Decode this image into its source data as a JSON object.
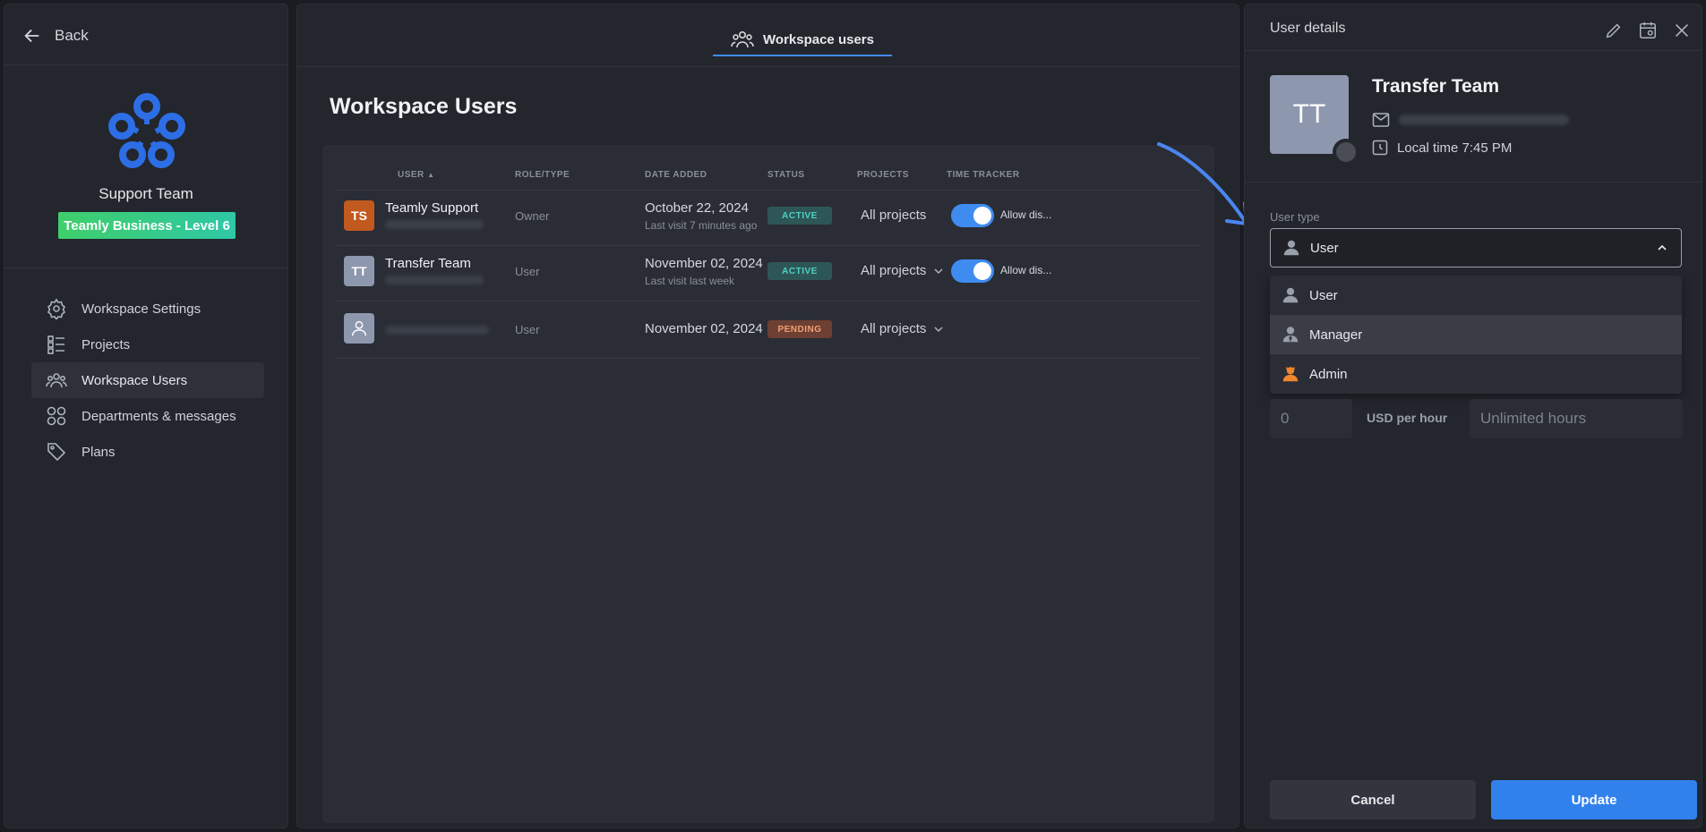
{
  "sidebar": {
    "back_label": "Back",
    "team_name": "Support Team",
    "plan_badge": "Teamly Business - Level 6",
    "nav": [
      {
        "label": "Workspace Settings",
        "icon": "gear-icon"
      },
      {
        "label": "Projects",
        "icon": "list-icon"
      },
      {
        "label": "Workspace Users",
        "icon": "users-icon"
      },
      {
        "label": "Departments & messages",
        "icon": "grid-icon"
      },
      {
        "label": "Plans",
        "icon": "tag-icon"
      }
    ]
  },
  "main": {
    "tab_label": "Workspace users",
    "title": "Workspace Users",
    "columns": {
      "user": "USER",
      "role": "ROLE/TYPE",
      "date": "DATE ADDED",
      "status": "STATUS",
      "projects": "PROJECTS",
      "time_tracker": "TIME TRACKER"
    },
    "rows": [
      {
        "initials": "TS",
        "name": "Teamly Support",
        "role": "Owner",
        "date": "October 22, 2024",
        "last_visit": "Last visit 7 minutes ago",
        "status": "ACTIVE",
        "projects": "All projects",
        "tracker_label": "Allow dis..."
      },
      {
        "initials": "TT",
        "name": "Transfer Team",
        "role": "User",
        "date": "November 02, 2024",
        "last_visit": "Last visit last week",
        "status": "ACTIVE",
        "projects": "All projects",
        "tracker_label": "Allow dis..."
      },
      {
        "initials": "",
        "name": "",
        "role": "User",
        "date": "November 02, 2024",
        "last_visit": "",
        "status": "PENDING",
        "projects": "All projects",
        "tracker_label": ""
      }
    ]
  },
  "details": {
    "title": "User details",
    "avatar_initials": "TT",
    "name": "Transfer Team",
    "local_time": "Local time 7:45 PM",
    "user_type_label": "User type",
    "selected_type": "User",
    "options": [
      "User",
      "Manager",
      "Admin"
    ],
    "rate_value": "0",
    "rate_unit": "USD per hour",
    "hours_placeholder": "Unlimited hours",
    "cancel_label": "Cancel",
    "update_label": "Update"
  },
  "colors": {
    "accent": "#3f8cf0",
    "active_badge": "#4fd1c1",
    "pending_badge": "#f0a074",
    "owner_avatar": "#c15a1e",
    "user_avatar": "#8d97ad",
    "admin_icon": "#f0862d"
  }
}
